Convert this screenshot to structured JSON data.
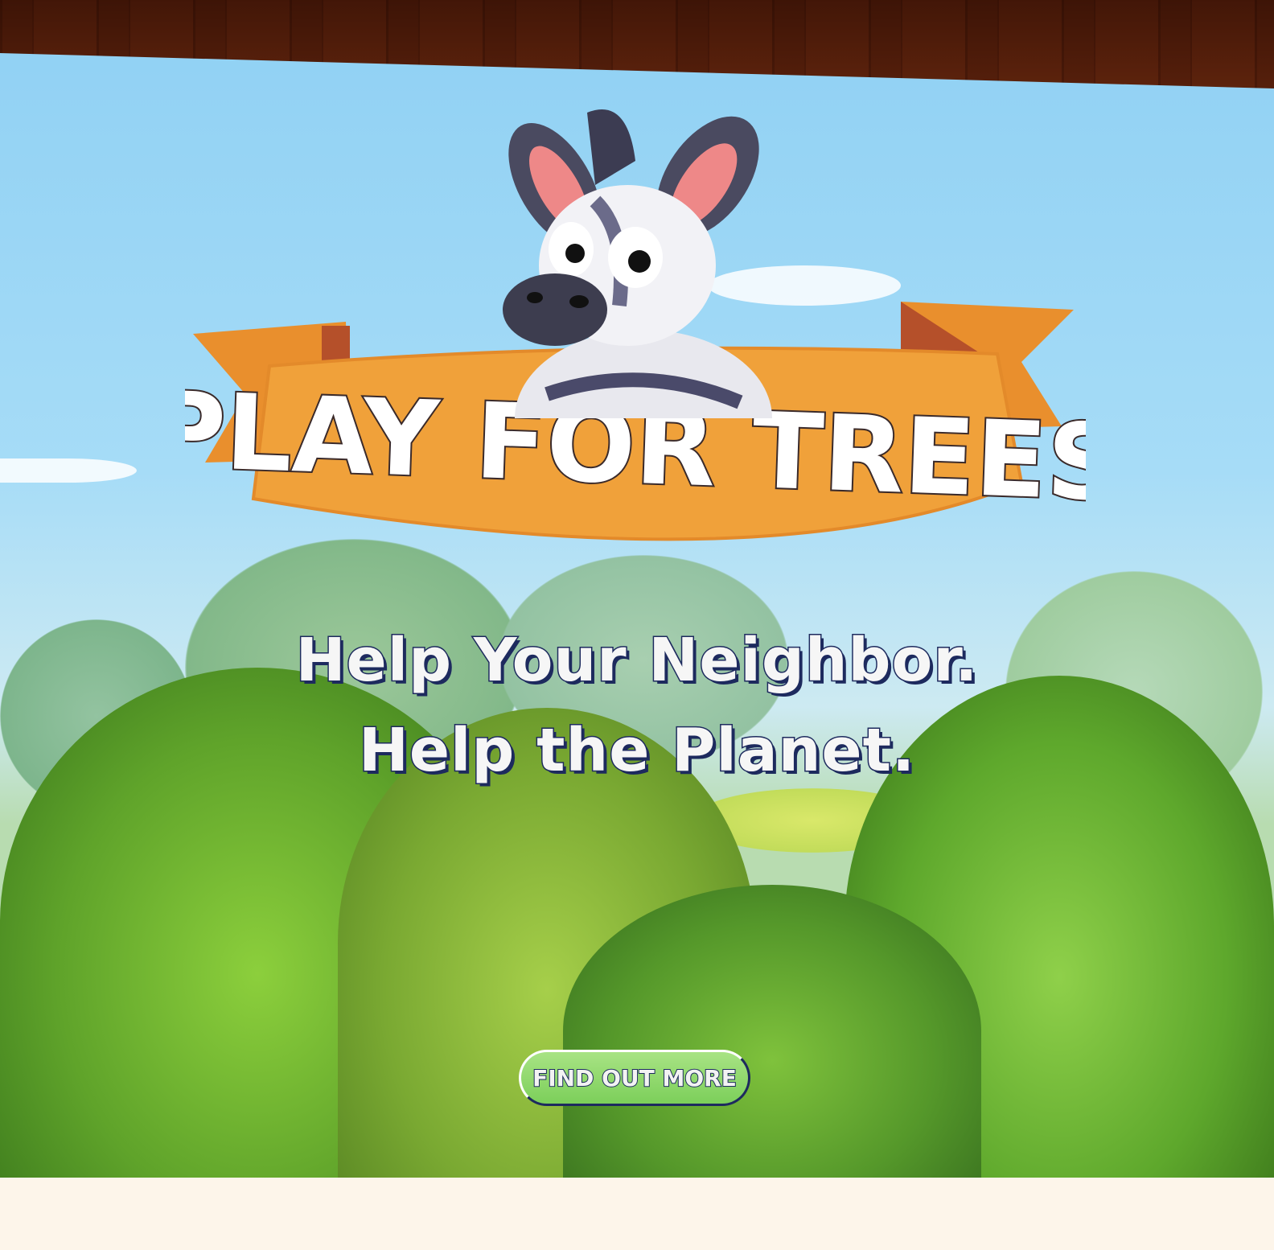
{
  "hero": {
    "title": "PLAY FOR TREES",
    "subtitle_line1": "Help Your Neighbor.",
    "subtitle_line2": "Help the Planet.",
    "cta_label": "FIND OUT MORE"
  },
  "colors": {
    "banner": "#f0a13a",
    "banner_dark": "#b5502a",
    "text_outline": "#1d2a5e",
    "button": "#8fd96a",
    "footer": "#fdf5ea"
  }
}
